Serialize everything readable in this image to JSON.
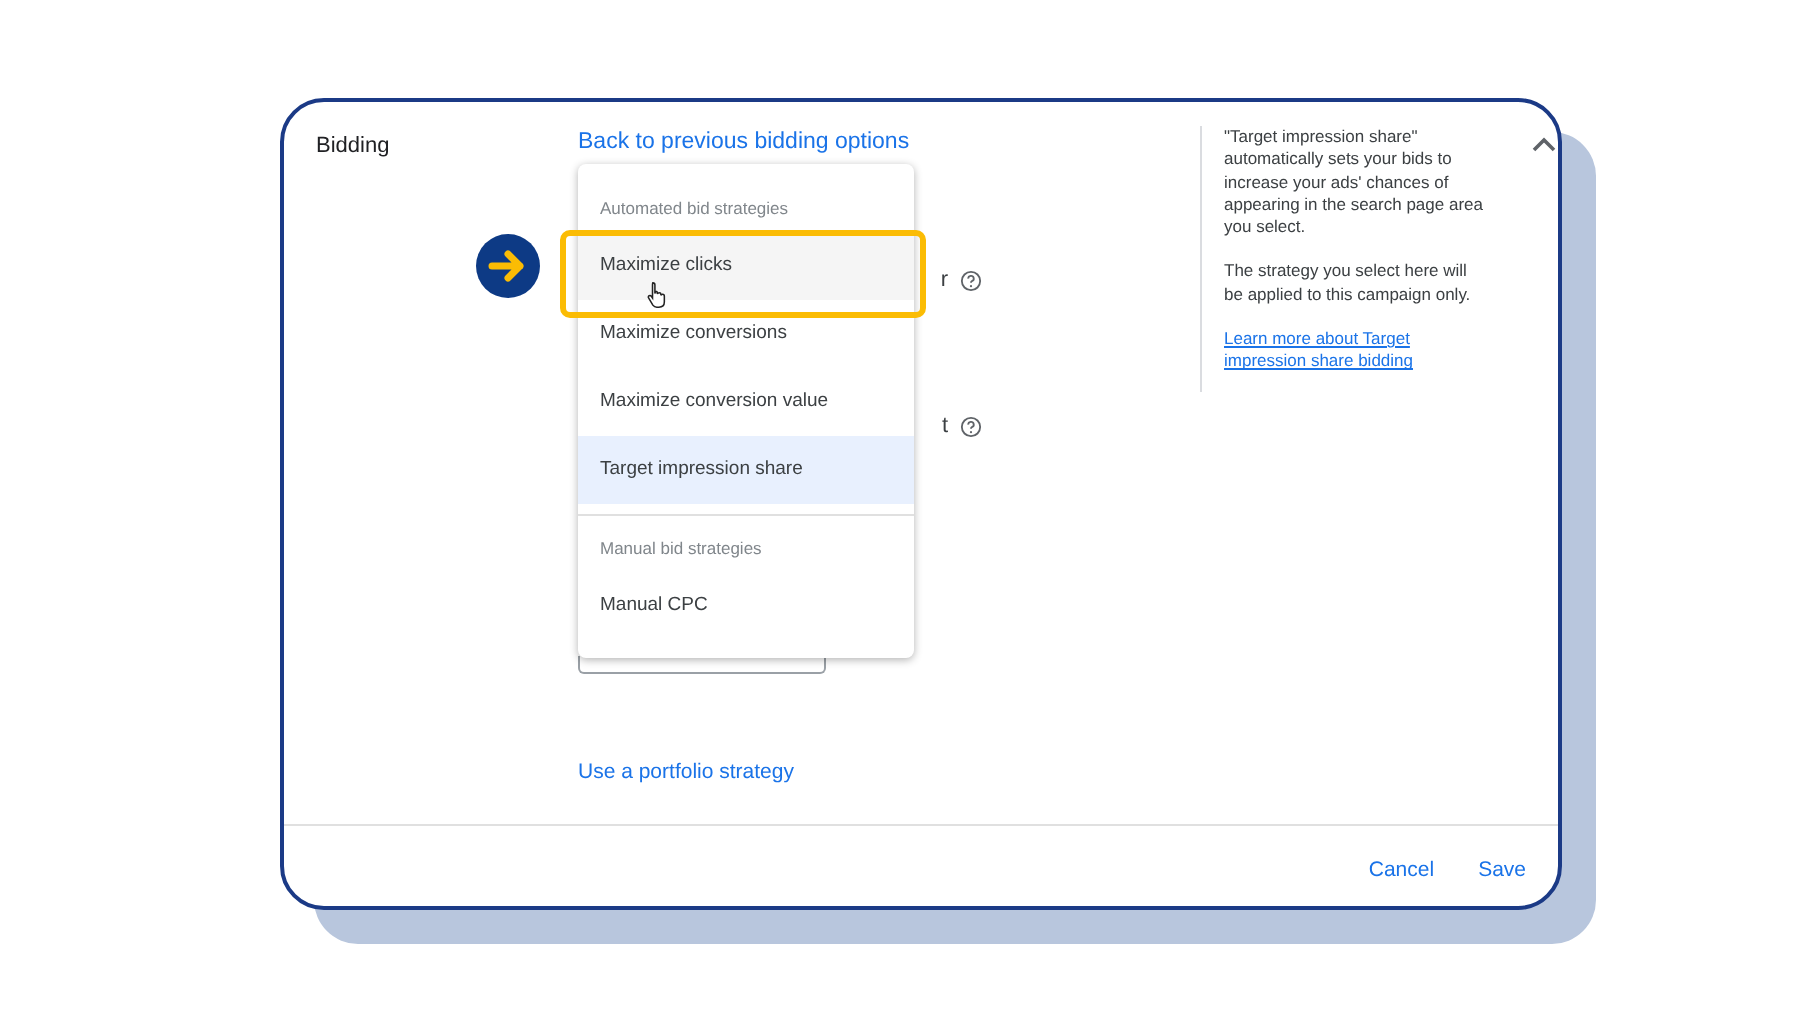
{
  "section": {
    "title": "Bidding",
    "back_link": "Back to previous bidding options",
    "portfolio_link": "Use a portfolio strategy",
    "expanded": true
  },
  "behind_rows": [
    {
      "text": "r"
    },
    {
      "text": "t"
    }
  ],
  "dropdown": {
    "items": [
      {
        "kind": "header",
        "label": "Automated bid strategies"
      },
      {
        "kind": "option",
        "label": "Maximize clicks",
        "selected": false,
        "hovered": true,
        "highlighted": true
      },
      {
        "kind": "option",
        "label": "Maximize conversions",
        "selected": false,
        "hovered": false,
        "highlighted": false
      },
      {
        "kind": "option",
        "label": "Maximize conversion value",
        "selected": false,
        "hovered": false,
        "highlighted": false
      },
      {
        "kind": "option",
        "label": "Target impression share",
        "selected": true,
        "hovered": false,
        "highlighted": false
      },
      {
        "kind": "divider"
      },
      {
        "kind": "header",
        "label": "Manual bid strategies"
      },
      {
        "kind": "option",
        "label": "Manual CPC",
        "selected": false,
        "hovered": false,
        "highlighted": false
      }
    ]
  },
  "help_panel": {
    "paragraphs": [
      "\"Target impression share\" automatically sets your bids to increase your ads' chances of appearing in the search page area you select.",
      "The strategy you select here will be applied to this campaign only."
    ],
    "link": "Learn more about Target impression share bidding"
  },
  "footer": {
    "buttons": [
      "Cancel",
      "Save"
    ]
  }
}
